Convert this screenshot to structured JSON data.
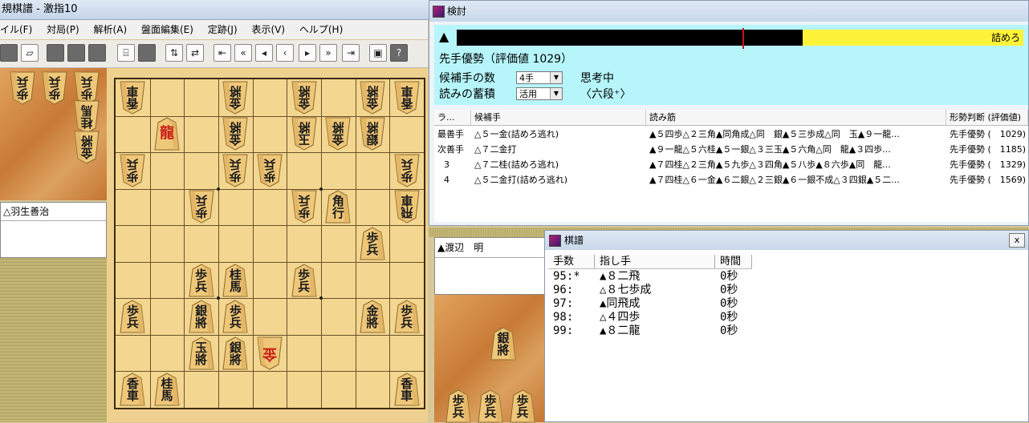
{
  "main_window": {
    "title": "規棋譜 - 激指10",
    "menu": [
      "イル(F)",
      "対局(P)",
      "解析(A)",
      "盤面編集(E)",
      "定跡(J)",
      "表示(V)",
      "ヘルプ(H)"
    ]
  },
  "players": {
    "gote": "△羽生善治",
    "sente": "▲渡辺　明"
  },
  "board": {
    "pieces": [
      {
        "col": 1,
        "row": 1,
        "t": [
          "香",
          "車"
        ],
        "gote": true
      },
      {
        "col": 4,
        "row": 1,
        "t": [
          "金",
          "將"
        ],
        "gote": true
      },
      {
        "col": 6,
        "row": 1,
        "t": [
          "金",
          "將"
        ],
        "gote": true
      },
      {
        "col": 8,
        "row": 1,
        "t": [
          "金",
          "將"
        ],
        "gote": true
      },
      {
        "col": 9,
        "row": 1,
        "t": [
          "香",
          "車"
        ],
        "gote": true
      },
      {
        "col": 2,
        "row": 2,
        "t": [
          "龍"
        ],
        "gote": false,
        "red": true
      },
      {
        "col": 4,
        "row": 2,
        "t": [
          "金",
          "將"
        ],
        "gote": true
      },
      {
        "col": 6,
        "row": 2,
        "t": [
          "玉",
          "將"
        ],
        "gote": true
      },
      {
        "col": 7,
        "row": 2,
        "t": [
          "金",
          "將"
        ],
        "gote": true
      },
      {
        "col": 8,
        "row": 2,
        "t": [
          "銀",
          "將"
        ],
        "gote": true
      },
      {
        "col": 1,
        "row": 3,
        "t": [
          "歩",
          "兵"
        ],
        "gote": true
      },
      {
        "col": 4,
        "row": 3,
        "t": [
          "歩",
          "兵"
        ],
        "gote": true
      },
      {
        "col": 5,
        "row": 3,
        "t": [
          "歩",
          "兵"
        ],
        "gote": true
      },
      {
        "col": 9,
        "row": 3,
        "t": [
          "歩",
          "兵"
        ],
        "gote": true
      },
      {
        "col": 3,
        "row": 4,
        "t": [
          "歩",
          "兵"
        ],
        "gote": true
      },
      {
        "col": 6,
        "row": 4,
        "t": [
          "歩",
          "兵"
        ],
        "gote": true
      },
      {
        "col": 7,
        "row": 4,
        "t": [
          "角",
          "行"
        ],
        "gote": false
      },
      {
        "col": 9,
        "row": 4,
        "t": [
          "飛",
          "車"
        ],
        "gote": true
      },
      {
        "col": 8,
        "row": 5,
        "t": [
          "歩",
          "兵"
        ],
        "gote": false
      },
      {
        "col": 3,
        "row": 6,
        "t": [
          "歩",
          "兵"
        ],
        "gote": false
      },
      {
        "col": 4,
        "row": 6,
        "t": [
          "桂",
          "馬"
        ],
        "gote": false
      },
      {
        "col": 6,
        "row": 6,
        "t": [
          "歩",
          "兵"
        ],
        "gote": false
      },
      {
        "col": 1,
        "row": 7,
        "t": [
          "歩",
          "兵"
        ],
        "gote": false
      },
      {
        "col": 3,
        "row": 7,
        "t": [
          "銀",
          "將"
        ],
        "gote": false
      },
      {
        "col": 4,
        "row": 7,
        "t": [
          "歩",
          "兵"
        ],
        "gote": false
      },
      {
        "col": 8,
        "row": 7,
        "t": [
          "金",
          "將"
        ],
        "gote": false
      },
      {
        "col": 9,
        "row": 7,
        "t": [
          "歩",
          "兵"
        ],
        "gote": false
      },
      {
        "col": 3,
        "row": 8,
        "t": [
          "玉",
          "將"
        ],
        "gote": false
      },
      {
        "col": 4,
        "row": 8,
        "t": [
          "銀",
          "將"
        ],
        "gote": false
      },
      {
        "col": 5,
        "row": 8,
        "t": [
          "金"
        ],
        "gote": true,
        "red": true
      },
      {
        "col": 1,
        "row": 9,
        "t": [
          "香",
          "車"
        ],
        "gote": false
      },
      {
        "col": 2,
        "row": 9,
        "t": [
          "桂",
          "馬"
        ],
        "gote": false
      },
      {
        "col": 9,
        "row": 9,
        "t": [
          "香",
          "車"
        ],
        "gote": false
      }
    ]
  },
  "gote_hand": [
    {
      "t": [
        "歩",
        "兵"
      ]
    },
    {
      "t": [
        "歩",
        "兵"
      ]
    },
    {
      "t": [
        "歩",
        "兵"
      ]
    },
    {
      "t": [
        "桂",
        "馬"
      ]
    },
    {
      "t": [
        "金",
        "將"
      ]
    }
  ],
  "sente_hand": [
    {
      "t": [
        "銀",
        "將"
      ]
    },
    {
      "t": [
        "歩",
        "兵"
      ]
    },
    {
      "t": [
        "歩",
        "兵"
      ]
    },
    {
      "t": [
        "歩",
        "兵"
      ]
    }
  ],
  "analysis": {
    "title": "検討",
    "eval_marker": "▲",
    "eval_bar_label": "詰めろ",
    "eval_fraction": 0.39,
    "status": "先手優勢（評価値 1029）",
    "candidates_label": "候補手の数",
    "candidates_value": "4手",
    "thinking": "思考中",
    "accumulate_label": "読みの蓄積",
    "accumulate_value": "活用",
    "level": "〈六段⁺〉",
    "columns": [
      "ラ...",
      "候補手",
      "読み筋",
      "形勢判断 (評価値)"
    ],
    "rows": [
      {
        "rank": "最善手",
        "move": "△５一金(詰めろ逃れ)",
        "pv": "▲５四歩△２三角▲同角成△同　銀▲５三歩成△同　玉▲９一龍...",
        "eval": "先手優勢 (　1029)"
      },
      {
        "rank": "次善手",
        "move": "△７二金打",
        "pv": "▲９一龍△５六桂▲５一銀△３三玉▲５六角△同　龍▲３四歩...",
        "eval": "先手優勢 (　1185)"
      },
      {
        "rank": "3",
        "move": "△７二桂(詰めろ逃れ)",
        "pv": "▲７四桂△２三角▲５九歩△３四角▲５八歩▲８六歩▲同　龍...",
        "eval": "先手優勢 (　1329)"
      },
      {
        "rank": "4",
        "move": "△５二金打(詰めろ逃れ)",
        "pv": "▲７四桂△６一金▲６二銀△２三銀▲６一銀不成△３四銀▲５二...",
        "eval": "先手優勢 (　1569)"
      }
    ]
  },
  "kifu": {
    "title": "棋譜",
    "close": "x",
    "columns": [
      "手数",
      "指し手",
      "時間"
    ],
    "rows": [
      {
        "num": "95:*",
        "move": "▲８二飛",
        "time": "0秒"
      },
      {
        "num": "96:",
        "move": "△８七歩成",
        "time": "0秒"
      },
      {
        "num": "97:",
        "move": "▲同飛成",
        "time": "0秒"
      },
      {
        "num": "98:",
        "move": "△４四歩",
        "time": "0秒"
      },
      {
        "num": "99:",
        "move": "▲８二龍",
        "time": "0秒"
      }
    ]
  }
}
